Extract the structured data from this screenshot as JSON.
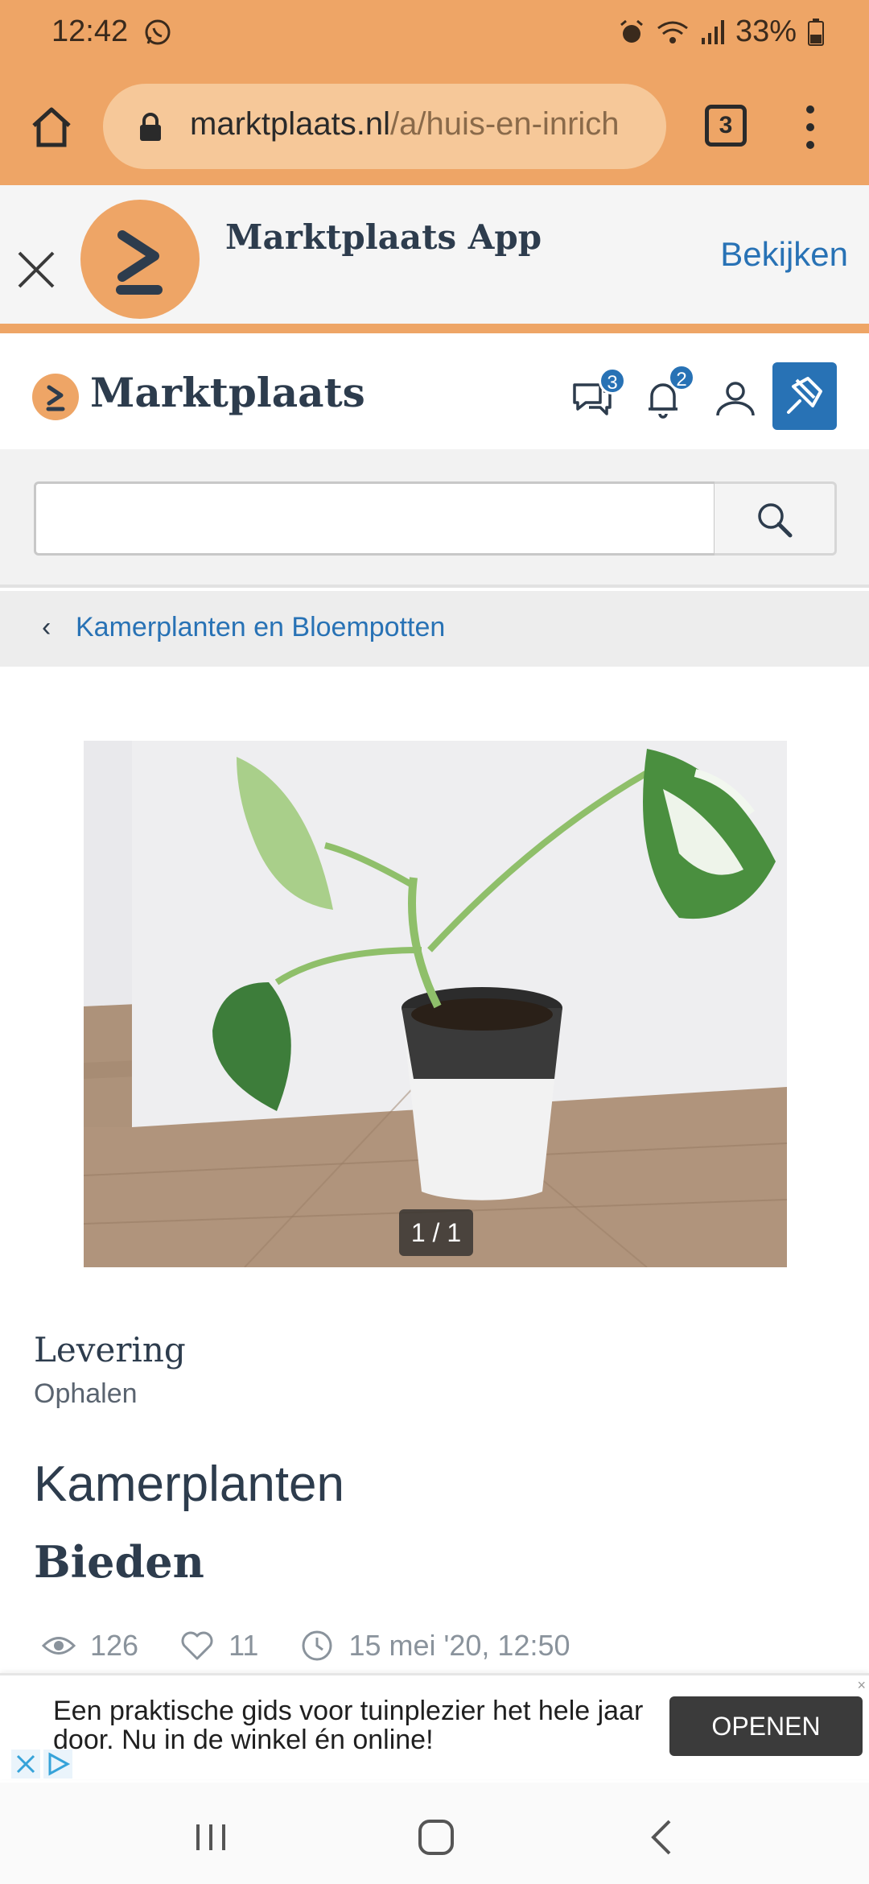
{
  "status_bar": {
    "time": "12:42",
    "battery": "33%",
    "icons": [
      "whatsapp-icon",
      "alarm-icon",
      "wifi-icon",
      "signal-icon",
      "battery-icon"
    ]
  },
  "browser": {
    "url_domain": "marktplaats.nl",
    "url_path": "/a/huis-en-inrich",
    "tab_count": "3"
  },
  "app_banner": {
    "app_name": "Marktplaats App",
    "view_label": "Bekijken"
  },
  "header": {
    "site_name": "Marktplaats",
    "messages_count": "3",
    "notifications_count": "2"
  },
  "search": {
    "value": "",
    "placeholder": ""
  },
  "breadcrumb": {
    "label": "Kamerplanten en Bloempotten"
  },
  "listing": {
    "photo_counter": "1 / 1",
    "delivery_label": "Levering",
    "delivery_value": "Ophalen",
    "title": "Kamerplanten",
    "price": "Bieden",
    "views": "126",
    "favorites": "11",
    "posted": "15 mei '20, 12:50"
  },
  "ad": {
    "text": "Een praktische gids voor tuinplezier het hele jaar door. Nu in de winkel én online!",
    "button_label": "OPENEN"
  },
  "colors": {
    "brand_orange": "#eea566",
    "brand_blue": "#2872b5",
    "text_dark": "#2d3c4d"
  }
}
